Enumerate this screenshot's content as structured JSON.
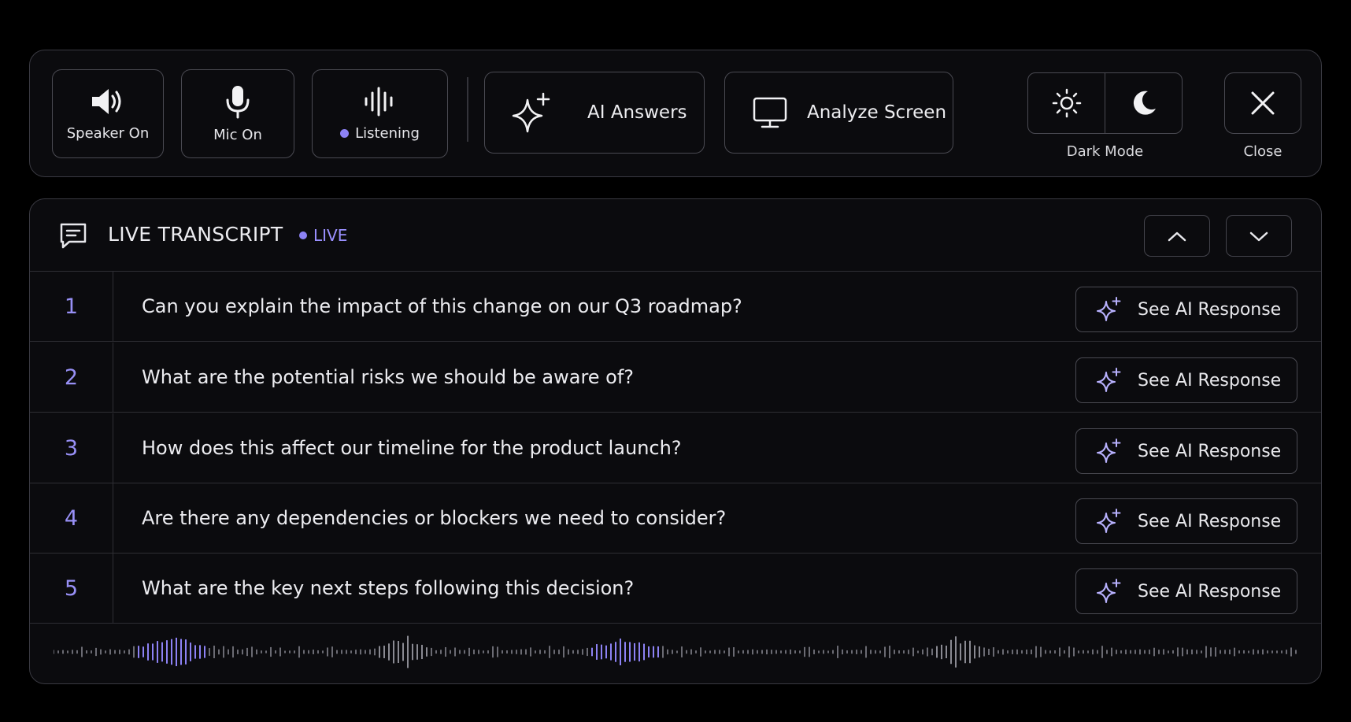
{
  "toolbar": {
    "speaker_label": "Speaker On",
    "mic_label": "Mic On",
    "listening_label": "Listening",
    "ai_answers_label": "AI Answers",
    "analyze_label": "Analyze Screen",
    "dark_mode_label": "Dark Mode",
    "close_label": "Close"
  },
  "transcript": {
    "title": "LIVE TRANSCRIPT",
    "live_label": "LIVE",
    "response_label": "See AI Response",
    "rows": [
      {
        "num": "1",
        "text": "Can you explain the impact of this change on our Q3 roadmap?"
      },
      {
        "num": "2",
        "text": "What are the potential risks we should be aware of?"
      },
      {
        "num": "3",
        "text": "How does this affect our timeline for the product launch?"
      },
      {
        "num": "4",
        "text": "Are there any dependencies or blockers we need to consider?"
      },
      {
        "num": "5",
        "text": "What are the key next steps following this decision?"
      }
    ]
  },
  "colors": {
    "accent": "#8d82f5",
    "panel_bg": "#0b0b0e",
    "border": "#3a3a42"
  },
  "icons": [
    "speaker-icon",
    "mic-icon",
    "waveform-icon",
    "sparkle-icon",
    "monitor-icon",
    "sun-icon",
    "moon-icon",
    "close-icon",
    "chat-icon",
    "chevron-up-icon",
    "chevron-down-icon"
  ]
}
